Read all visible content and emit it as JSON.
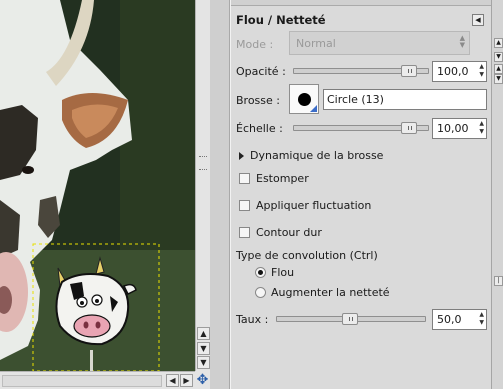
{
  "panel": {
    "title": "Flou / Netteté",
    "mode_label": "Mode :",
    "mode_value": "Normal",
    "opacity_label": "Opacité :",
    "opacity_value": "100,0",
    "opacity_level": 1.0,
    "brush_label": "Brosse :",
    "brush_name": "Circle (13)",
    "scale_label": "Échelle :",
    "scale_value": "10,00",
    "scale_level": 1.0,
    "dynamics_label": "Dynamique de la brosse",
    "options": [
      {
        "label": "Estomper",
        "checked": false
      },
      {
        "label": "Appliquer fluctuation",
        "checked": false
      },
      {
        "label": "Contour dur",
        "checked": false
      }
    ],
    "convolve_label": "Type de convolution  (Ctrl)",
    "convolve_options": [
      {
        "label": "Flou",
        "selected": true
      },
      {
        "label": "Augmenter la netteté",
        "selected": false
      }
    ],
    "rate_label": "Taux :",
    "rate_value": "50,0",
    "rate_level": 0.5
  },
  "icons": {
    "panel_menu": "panel-menu-icon",
    "navigate": "navigate-icon",
    "brush_preview": "brush-circle-icon"
  },
  "colors": {
    "panel_bg": "#dadada",
    "selection_dash": "#e8e000",
    "brush_corner": "#3a6cc8"
  }
}
